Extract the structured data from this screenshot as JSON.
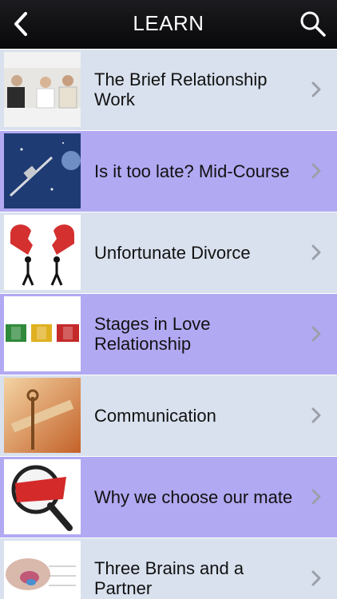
{
  "header": {
    "title": "LEARN",
    "back_icon": "chevron-left-icon",
    "search_icon": "search-icon"
  },
  "colors": {
    "navbar": "#0f0f12",
    "row_light": "#d9e1ee",
    "row_purple": "#b2a9f3",
    "chevron": "#9a9fa8"
  },
  "list": {
    "items": [
      {
        "title": "The Brief Relationship Work",
        "thumbnail": "group-photo"
      },
      {
        "title": "Is it too late?  Mid-Course",
        "thumbnail": "space-satellite"
      },
      {
        "title": "Unfortunate Divorce",
        "thumbnail": "broken-heart"
      },
      {
        "title": "Stages in Love Relationship",
        "thumbnail": "one-two-three"
      },
      {
        "title": "Communication",
        "thumbnail": "communication-signpost"
      },
      {
        "title": "Why we choose our mate",
        "thumbnail": "why-magnifier"
      },
      {
        "title": "Three Brains and a Partner",
        "thumbnail": "brain-diagram"
      }
    ],
    "chevron_icon": "chevron-right-icon"
  }
}
